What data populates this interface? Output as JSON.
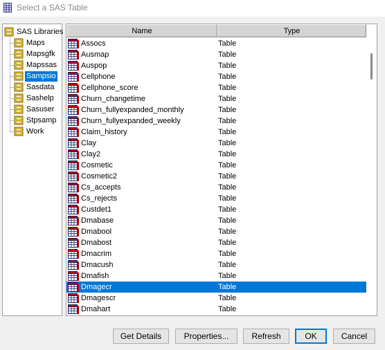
{
  "window": {
    "title": "Select a SAS Table"
  },
  "tree": {
    "root_label": "SAS Libraries",
    "items": [
      {
        "label": "Maps"
      },
      {
        "label": "Mapsgfk"
      },
      {
        "label": "Mapssas"
      },
      {
        "label": "Sampsio",
        "selected": true
      },
      {
        "label": "Sasdata"
      },
      {
        "label": "Sashelp"
      },
      {
        "label": "Sasuser"
      },
      {
        "label": "Stpsamp"
      },
      {
        "label": "Work"
      }
    ]
  },
  "table": {
    "columns": {
      "name": "Name",
      "type": "Type"
    },
    "rows": [
      {
        "name": "Assocs",
        "type": "Table"
      },
      {
        "name": "Ausmap",
        "type": "Table"
      },
      {
        "name": "Auspop",
        "type": "Table"
      },
      {
        "name": "Cellphone",
        "type": "Table"
      },
      {
        "name": "Cellphone_score",
        "type": "Table"
      },
      {
        "name": "Churn_changetime",
        "type": "Table"
      },
      {
        "name": "Churn_fullyexpanded_monthly",
        "type": "Table"
      },
      {
        "name": "Churn_fullyexpanded_weekly",
        "type": "Table"
      },
      {
        "name": "Claim_history",
        "type": "Table"
      },
      {
        "name": "Clay",
        "type": "Table"
      },
      {
        "name": "Clay2",
        "type": "Table"
      },
      {
        "name": "Cosmetic",
        "type": "Table"
      },
      {
        "name": "Cosmetic2",
        "type": "Table"
      },
      {
        "name": "Cs_accepts",
        "type": "Table"
      },
      {
        "name": "Cs_rejects",
        "type": "Table"
      },
      {
        "name": "Custdet1",
        "type": "Table"
      },
      {
        "name": "Dmabase",
        "type": "Table"
      },
      {
        "name": "Dmabool",
        "type": "Table"
      },
      {
        "name": "Dmabost",
        "type": "Table"
      },
      {
        "name": "Dmacrim",
        "type": "Table"
      },
      {
        "name": "Dmacush",
        "type": "Table"
      },
      {
        "name": "Dmafish",
        "type": "Table"
      },
      {
        "name": "Dmagecr",
        "type": "Table",
        "selected": true
      },
      {
        "name": "Dmagescr",
        "type": "Table"
      },
      {
        "name": "Dmahart",
        "type": "Table"
      }
    ]
  },
  "buttons": {
    "get_details": "Get Details",
    "properties": "Properties...",
    "refresh": "Refresh",
    "ok": "OK",
    "cancel": "Cancel"
  },
  "colors": {
    "selection": "#0078d7",
    "title_text": "#8a8a8a"
  },
  "icons": {
    "app": "sas-table-window-icon",
    "library": "library-drawer-icon",
    "table": "table-grid-icon"
  }
}
